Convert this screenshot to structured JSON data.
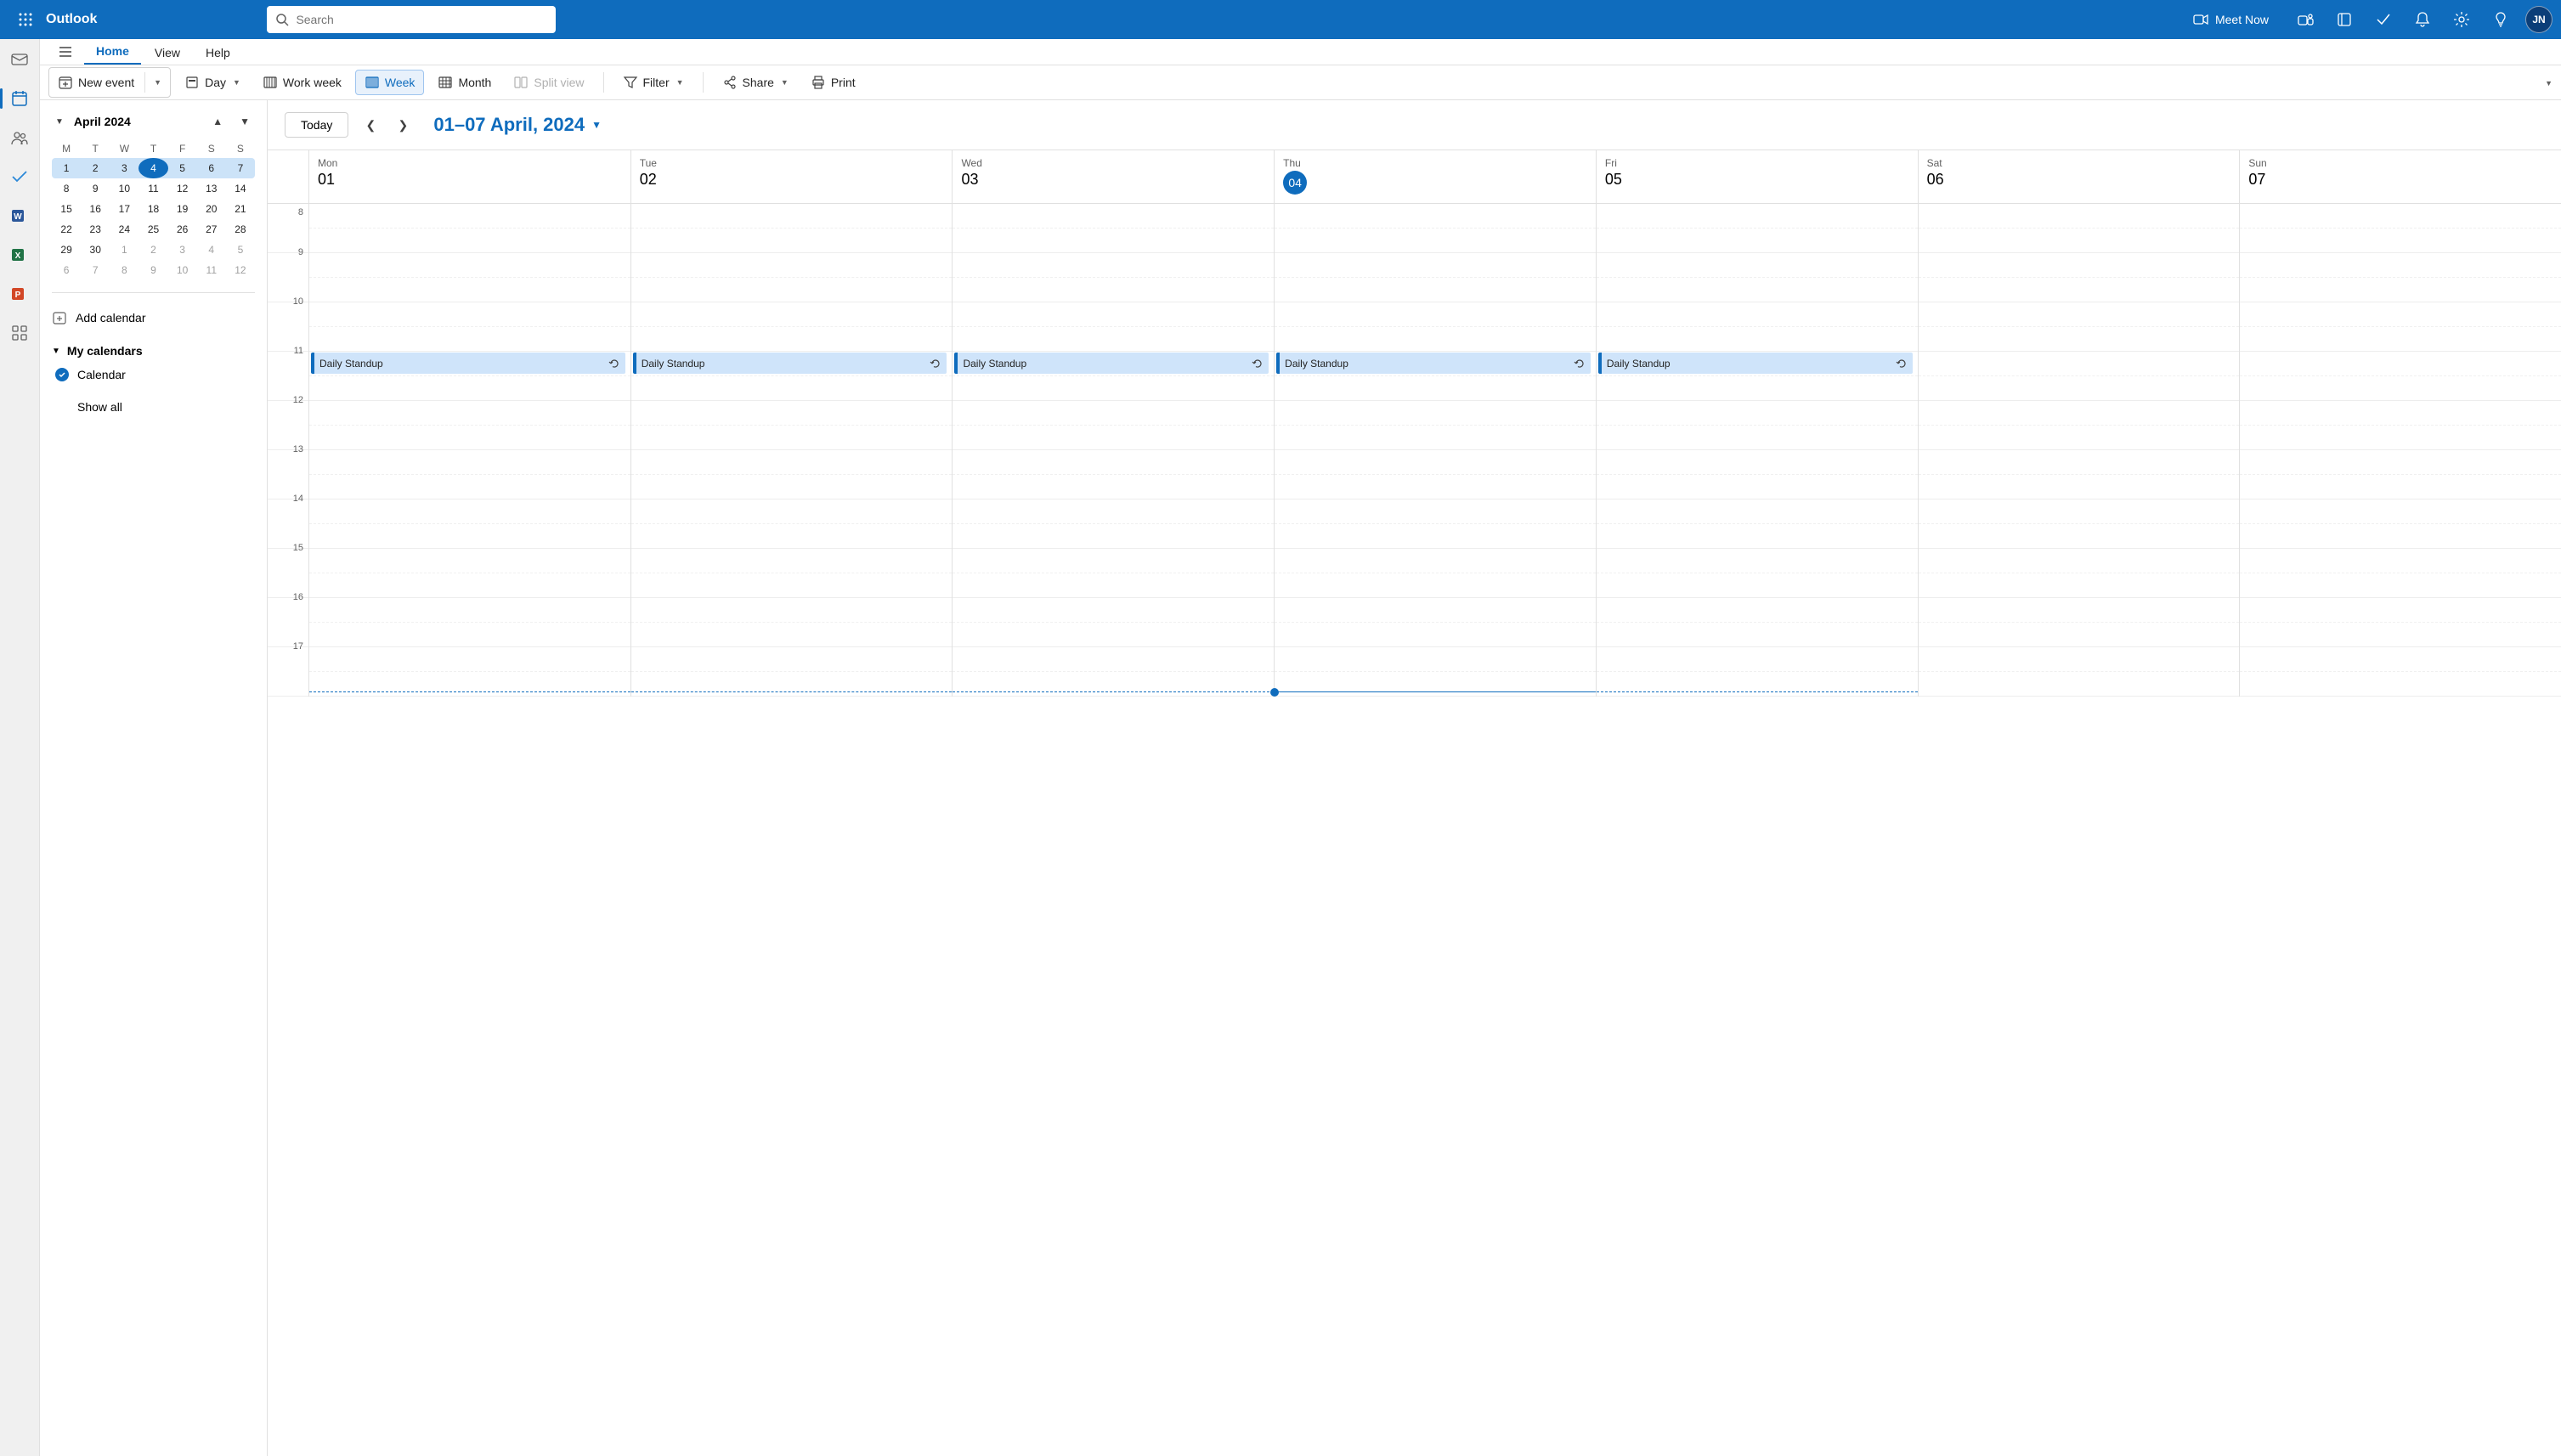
{
  "titlebar": {
    "brand": "Outlook",
    "search_placeholder": "Search",
    "meet_now": "Meet Now",
    "avatar_initials": "JN"
  },
  "tabs": {
    "home": "Home",
    "view": "View",
    "help": "Help"
  },
  "toolbar": {
    "new_event": "New event",
    "day": "Day",
    "work_week": "Work week",
    "week": "Week",
    "month": "Month",
    "split_view": "Split view",
    "filter": "Filter",
    "share": "Share",
    "print": "Print"
  },
  "mini_month": {
    "title": "April 2024",
    "dow": [
      "M",
      "T",
      "W",
      "T",
      "F",
      "S",
      "S"
    ],
    "weeks": [
      {
        "selected": true,
        "days": [
          {
            "n": "1"
          },
          {
            "n": "2"
          },
          {
            "n": "3"
          },
          {
            "n": "4",
            "today": true
          },
          {
            "n": "5"
          },
          {
            "n": "6"
          },
          {
            "n": "7"
          }
        ]
      },
      {
        "days": [
          {
            "n": "8"
          },
          {
            "n": "9"
          },
          {
            "n": "10"
          },
          {
            "n": "11"
          },
          {
            "n": "12"
          },
          {
            "n": "13"
          },
          {
            "n": "14"
          }
        ]
      },
      {
        "days": [
          {
            "n": "15"
          },
          {
            "n": "16"
          },
          {
            "n": "17"
          },
          {
            "n": "18"
          },
          {
            "n": "19"
          },
          {
            "n": "20"
          },
          {
            "n": "21"
          }
        ]
      },
      {
        "days": [
          {
            "n": "22"
          },
          {
            "n": "23"
          },
          {
            "n": "24"
          },
          {
            "n": "25"
          },
          {
            "n": "26"
          },
          {
            "n": "27"
          },
          {
            "n": "28"
          }
        ]
      },
      {
        "days": [
          {
            "n": "29"
          },
          {
            "n": "30"
          },
          {
            "n": "1",
            "other": true
          },
          {
            "n": "2",
            "other": true
          },
          {
            "n": "3",
            "other": true
          },
          {
            "n": "4",
            "other": true
          },
          {
            "n": "5",
            "other": true
          }
        ]
      },
      {
        "days": [
          {
            "n": "6",
            "other": true
          },
          {
            "n": "7",
            "other": true
          },
          {
            "n": "8",
            "other": true
          },
          {
            "n": "9",
            "other": true
          },
          {
            "n": "10",
            "other": true
          },
          {
            "n": "11",
            "other": true
          },
          {
            "n": "12",
            "other": true
          }
        ]
      }
    ],
    "add_calendar": "Add calendar",
    "my_calendars": "My calendars",
    "calendar": "Calendar",
    "show_all": "Show all"
  },
  "calendar": {
    "today": "Today",
    "range": "01–07 April, 2024",
    "days": [
      {
        "name": "Mon",
        "num": "01"
      },
      {
        "name": "Tue",
        "num": "02"
      },
      {
        "name": "Wed",
        "num": "03"
      },
      {
        "name": "Thu",
        "num": "04",
        "today": true
      },
      {
        "name": "Fri",
        "num": "05"
      },
      {
        "name": "Sat",
        "num": "06"
      },
      {
        "name": "Sun",
        "num": "07"
      }
    ],
    "hours": [
      "8",
      "9",
      "10",
      "11",
      "12",
      "13",
      "14",
      "15",
      "16",
      "17"
    ],
    "events": [
      {
        "day": 0,
        "hour": 3,
        "title": "Daily Standup"
      },
      {
        "day": 1,
        "hour": 3,
        "title": "Daily Standup"
      },
      {
        "day": 2,
        "hour": 3,
        "title": "Daily Standup"
      },
      {
        "day": 3,
        "hour": 3,
        "title": "Daily Standup"
      },
      {
        "day": 4,
        "hour": 3,
        "title": "Daily Standup"
      }
    ],
    "now_hour_offset": 9.9
  },
  "colors": {
    "accent": "#0f6cbd"
  }
}
